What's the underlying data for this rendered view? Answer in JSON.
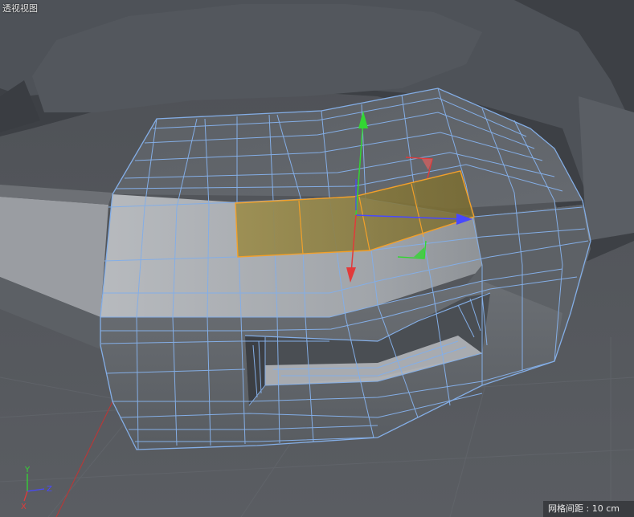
{
  "viewport": {
    "title": "透视视图",
    "grid_spacing_label": "网格间距 : 10 cm"
  },
  "axis_indicator": {
    "y_label": "Y",
    "z_label": "Z",
    "x_label": "X"
  },
  "colors": {
    "background": "#4a4d52",
    "wire": "#84aee6",
    "selection": "#f2a02a",
    "selection_fill": "#8a7a33",
    "axis_x": "#e23a3a",
    "axis_y": "#33d633",
    "axis_z": "#3a3ae6"
  }
}
